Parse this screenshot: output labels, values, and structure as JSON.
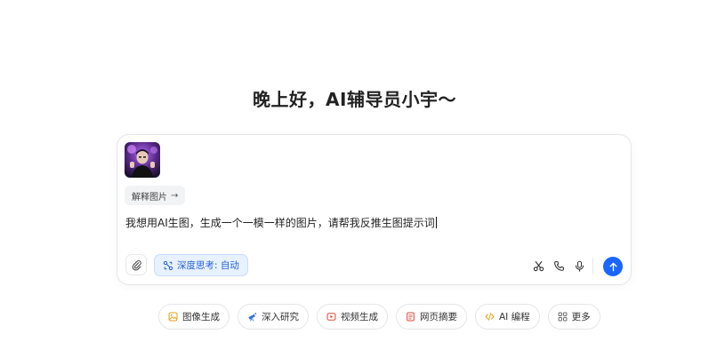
{
  "greeting": "晚上好，AI辅导员小宇～",
  "attachment": {
    "thumbnail_icon": "photo-thumbnail",
    "explain_chip_label": "解释图片",
    "explain_chip_icon": "arrow-right-icon"
  },
  "input": {
    "text": "我想用AI生图，生成一个一模一样的图片，请帮我反推生图提示词"
  },
  "toolbar": {
    "deep_think_label": "深度思考: 自动",
    "accent_color": "#1a66ff",
    "deep_think_color": "#2563d9",
    "icons": [
      "paperclip-icon",
      "scissors-icon",
      "phone-icon",
      "microphone-icon",
      "send-arrow-icon"
    ]
  },
  "quick_actions": [
    {
      "label": "图像生成",
      "icon": "image-icon",
      "color": "#e3a21a"
    },
    {
      "label": "深入研究",
      "icon": "telescope-icon",
      "color": "#2f6fe0"
    },
    {
      "label": "视频生成",
      "icon": "video-icon",
      "color": "#e0483a"
    },
    {
      "label": "网页摘要",
      "icon": "document-icon",
      "color": "#e0483a"
    },
    {
      "label": "AI 编程",
      "icon": "code-icon",
      "color": "#e3a21a"
    },
    {
      "label": "更多",
      "icon": "grid-icon",
      "color": "#666666"
    }
  ]
}
